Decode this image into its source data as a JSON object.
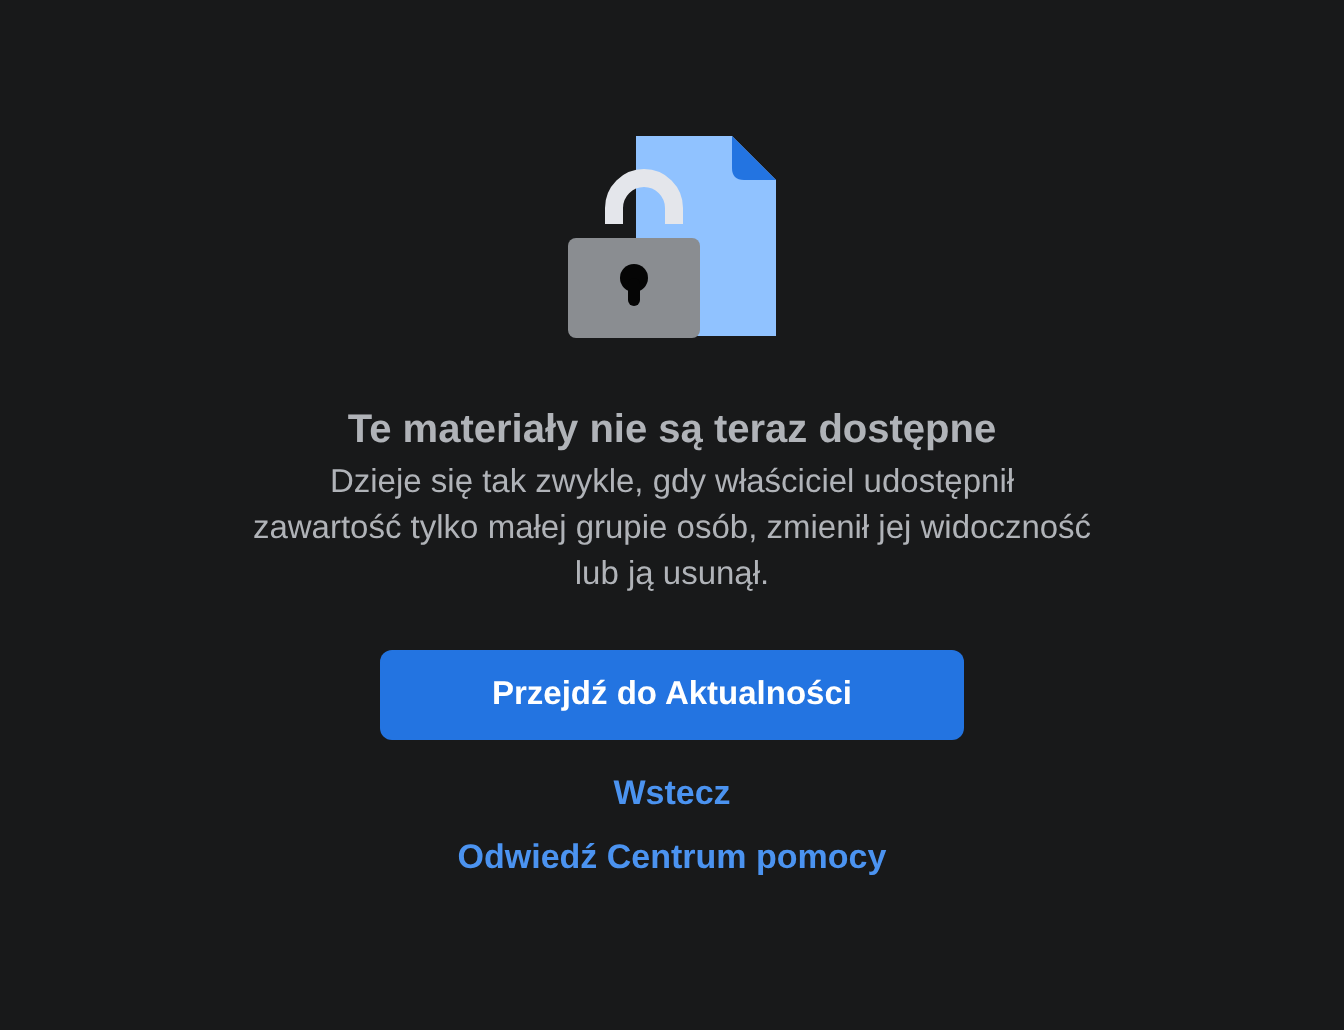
{
  "title": "Te materiały nie są teraz dostępne",
  "message": "Dzieje się tak zwykle, gdy właściciel udostępnił zawartość tylko małej grupie osób, zmienił jej widoczność lub ją usunął.",
  "primary_button": "Przejdź do Aktualności",
  "links": [
    "Wstecz",
    "Odwiedź Centrum pomocy"
  ]
}
